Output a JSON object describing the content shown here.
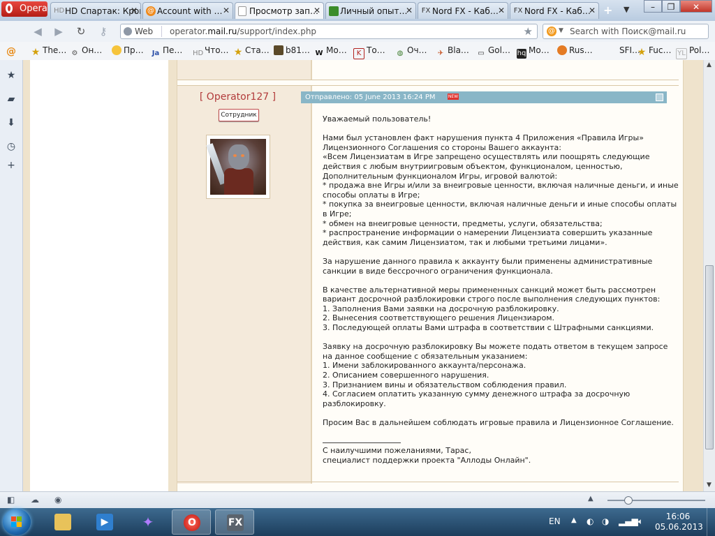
{
  "browser": {
    "menu_label": "Opera",
    "tabs": [
      {
        "title": "HD Спартак: Кров…",
        "favicon": "hd-icon",
        "active": false
      },
      {
        "title": "Account with …",
        "favicon": "mail-at-icon",
        "active": false
      },
      {
        "title": "Просмотр зап…",
        "favicon": "page-icon",
        "active": true
      },
      {
        "title": "Личный опыт…",
        "favicon": "green-square-icon",
        "active": false
      },
      {
        "title": "Nord FX - Каб…",
        "favicon": "fx-icon",
        "active": false
      },
      {
        "title": "Nord FX - Каб…",
        "favicon": "fx-icon",
        "active": false
      }
    ],
    "address": {
      "badge": "Web",
      "url_prefix": "operator.",
      "url_host": "mail.ru",
      "url_path": "/support/index.php"
    },
    "search": {
      "placeholder": "Search with Поиск@mail.ru"
    },
    "bookmarks": [
      {
        "label": "The…",
        "icon": "star-icon"
      },
      {
        "label": "Он…",
        "icon": "gear-icon"
      },
      {
        "label": "Пр…",
        "icon": "smile-icon"
      },
      {
        "label": "Пе…",
        "icon": "ja-icon"
      },
      {
        "label": "Что…",
        "icon": "hd-icon"
      },
      {
        "label": "Ста…",
        "icon": "star-icon"
      },
      {
        "label": "b81…",
        "icon": "game-icon"
      },
      {
        "label": "Мо…",
        "icon": "w-icon"
      },
      {
        "label": "То…",
        "icon": "k-icon"
      },
      {
        "label": "Оч…",
        "icon": "leaf-icon"
      },
      {
        "label": "Bla…",
        "icon": "bird-icon"
      },
      {
        "label": "Gol…",
        "icon": "monitor-icon"
      },
      {
        "label": "Мо…",
        "icon": "hq-icon"
      },
      {
        "label": "Rus…",
        "icon": "ball-icon"
      },
      {
        "label": "SFI…",
        "icon": "blank-icon"
      },
      {
        "label": "Fuc…",
        "icon": "star-icon"
      },
      {
        "label": "Pol…",
        "icon": "yl-icon"
      }
    ]
  },
  "post": {
    "username": "[ Operator127 ]",
    "role": "Сотрудник",
    "sent": "Отправлено: 05 June 2013 16:24 PM",
    "new_badge": "NEW",
    "body": [
      "Уважаемый пользователь!",
      "",
      "Нами был установлен факт нарушения пункта 4 Приложения «Правила Игры» Лицензионного Соглашения со стороны Вашего аккаунта:",
      "«Всем Лицензиатам в Игре запрещено осуществлять или поощрять следующие действия с любым внутриигровым объектом, функционалом, ценностью, Дополнительным функционалом Игры, игровой валютой:",
      "* продажа вне Игры и/или за внеигровые ценности, включая наличные деньги, и иные способы оплаты в Игре;",
      "* покупка за внеигровые ценности, включая наличные деньги и иные способы оплаты в Игре;",
      "* обмен на внеигровые ценности, предметы, услуги, обязательства;",
      "* распространение информации о намерении Лицензиата совершить указанные действия, как самим Лицензиатом, так и любыми третьими лицами».",
      "",
      "За нарушение данного правила к аккаунту были применены административные санкции в виде бессрочного ограничения функционала.",
      "",
      "В качестве альтернативной меры примененных санкций может быть рассмотрен вариант досрочной разблокировки строго после выполнения следующих пунктов:",
      "1. Заполнения Вами заявки на досрочную разблокировку.",
      "2. Вынесения соответствующего решения Лицензиаром.",
      "3. Последующей оплаты Вами штрафа в соответствии с Штрафными санкциями.",
      "",
      "Заявку на досрочную разблокировку Вы можете подать ответом в текущем запросе на данное сообщение с обязательным указанием:",
      "1. Имени заблокированного аккаунта/персонажа.",
      "2. Описанием совершенного нарушения.",
      "3. Признанием вины и обязательством соблюдения правил.",
      "4. Согласием оплатить указанную сумму денежного штрафа за досрочную разблокировку.",
      "",
      "Просим Вас в дальнейшем соблюдать игровые правила и Лицензионное Соглашение."
    ],
    "signature": [
      "С наилучшими пожеланиями, Тарас,",
      "специалист поддержки проекта \"Аллоды Онлайн\"."
    ]
  },
  "taskbar": {
    "lang": "EN",
    "time": "16:06",
    "date": "05.06.2013"
  }
}
